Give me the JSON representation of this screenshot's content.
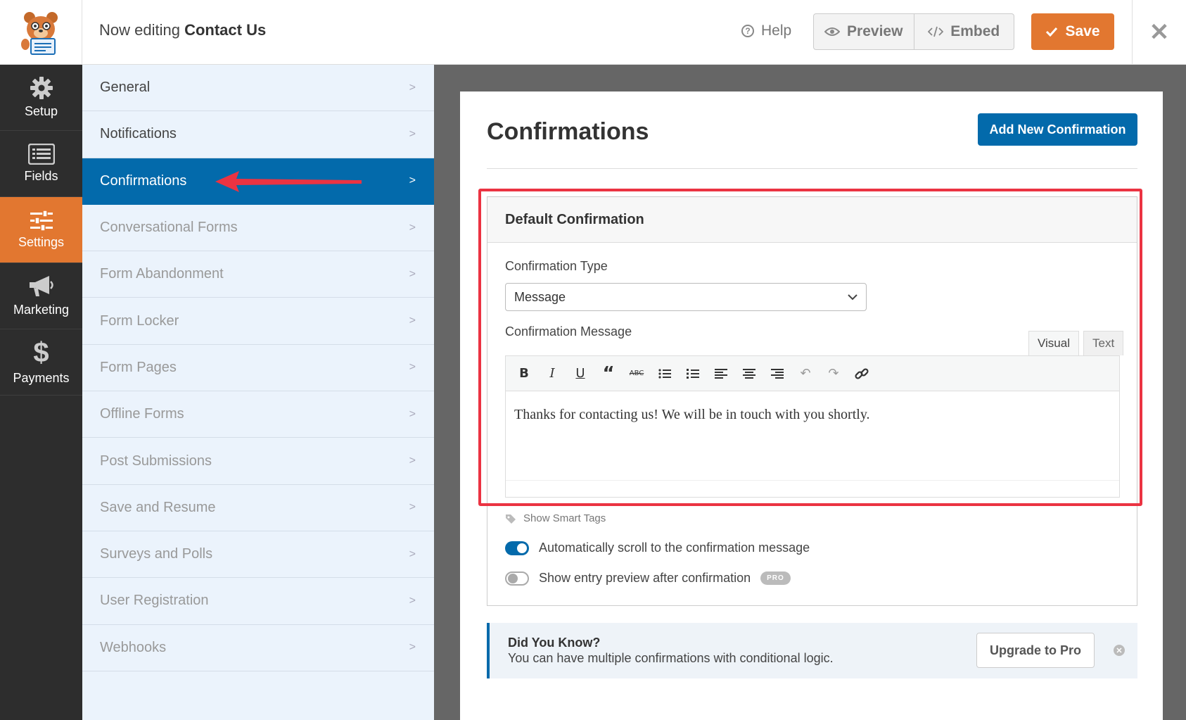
{
  "header": {
    "editing_prefix": "Now editing",
    "form_name": "Contact Us",
    "help_label": "Help",
    "preview_label": "Preview",
    "embed_label": "Embed",
    "save_label": "Save"
  },
  "leftnav": {
    "items": [
      {
        "label": "Setup",
        "icon": "gear-icon"
      },
      {
        "label": "Fields",
        "icon": "list-icon"
      },
      {
        "label": "Settings",
        "icon": "sliders-icon",
        "active": true
      },
      {
        "label": "Marketing",
        "icon": "megaphone-icon"
      },
      {
        "label": "Payments",
        "icon": "dollar-icon"
      }
    ]
  },
  "settings": {
    "items": [
      {
        "label": "General"
      },
      {
        "label": "Notifications"
      },
      {
        "label": "Confirmations"
      },
      {
        "label": "Conversational Forms"
      },
      {
        "label": "Form Abandonment"
      },
      {
        "label": "Form Locker"
      },
      {
        "label": "Form Pages"
      },
      {
        "label": "Offline Forms"
      },
      {
        "label": "Post Submissions"
      },
      {
        "label": "Save and Resume"
      },
      {
        "label": "Surveys and Polls"
      },
      {
        "label": "User Registration"
      },
      {
        "label": "Webhooks"
      }
    ]
  },
  "main": {
    "title": "Confirmations",
    "add_button": "Add New Confirmation",
    "box_title": "Default Confirmation",
    "type_label": "Confirmation Type",
    "type_value": "Message",
    "message_label": "Confirmation Message",
    "tab_visual": "Visual",
    "tab_text": "Text",
    "message_text": "Thanks for contacting us! We will be in touch with you shortly.",
    "smart_tags": "Show Smart Tags",
    "toggle_scroll": "Automatically scroll to the confirmation message",
    "toggle_preview": "Show entry preview after confirmation",
    "pro_badge": "PRO"
  },
  "notice": {
    "title": "Did You Know?",
    "text": "You can have multiple confirmations with conditional logic.",
    "button": "Upgrade to Pro"
  },
  "colors": {
    "accent_orange": "#e27730",
    "primary_blue": "#036aab",
    "highlight_red": "#eb3342"
  }
}
